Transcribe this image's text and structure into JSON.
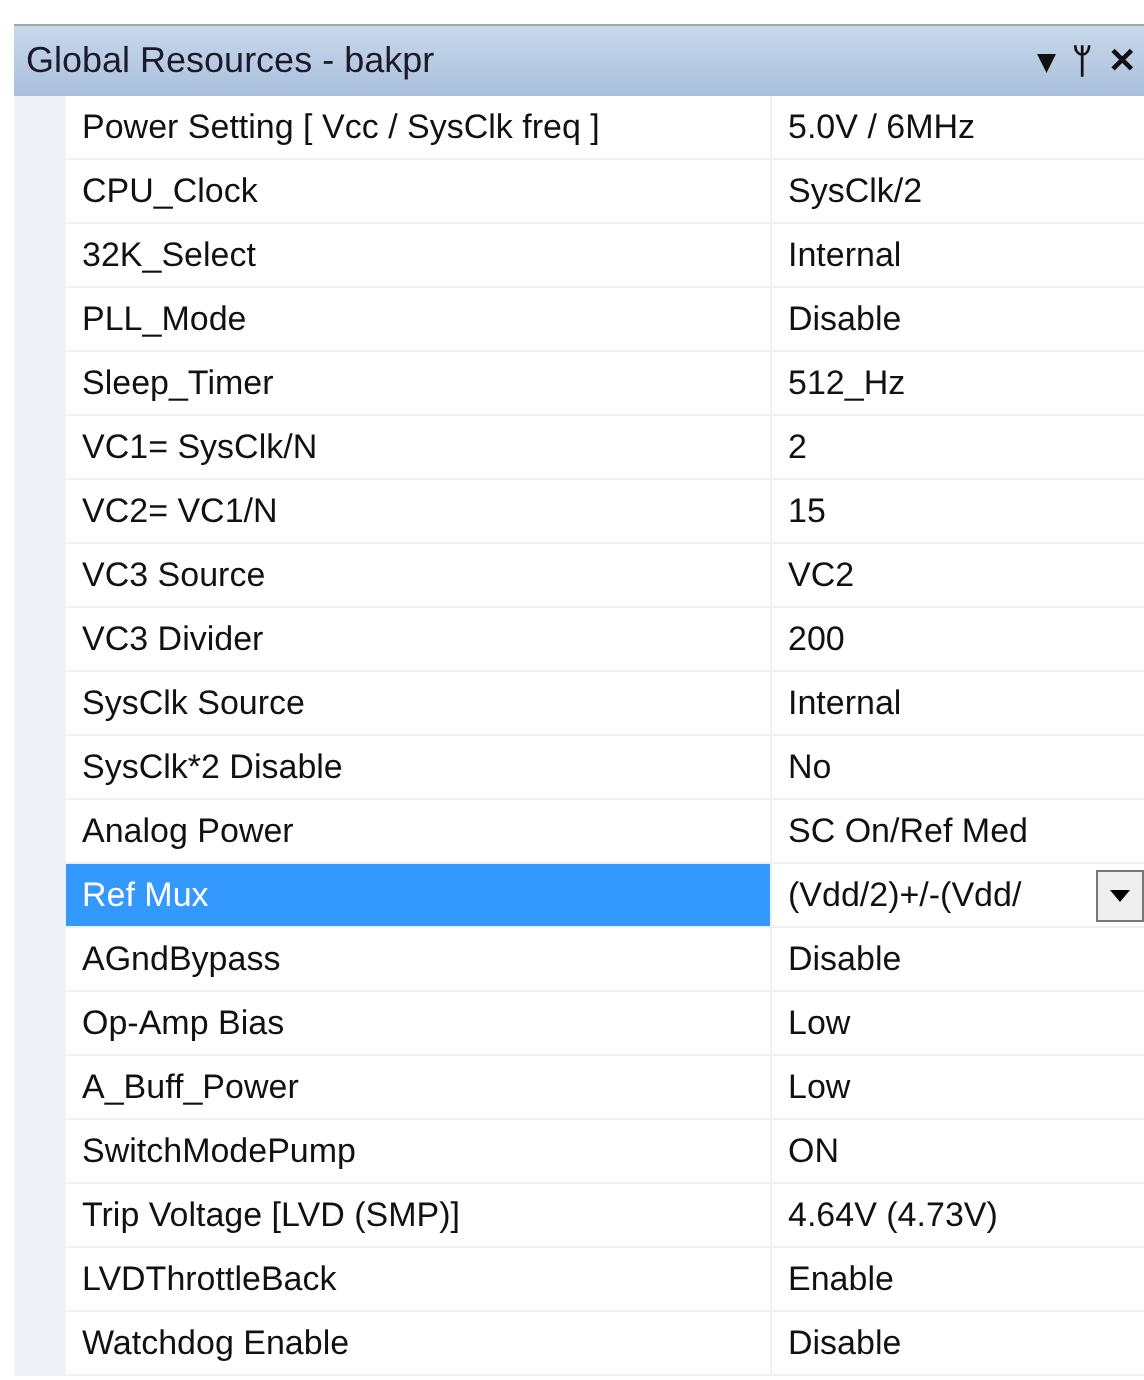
{
  "window": {
    "title": "Global Resources - bakpr",
    "buttons": [
      "▾",
      "ᛘ",
      "✕"
    ]
  },
  "properties": [
    {
      "name": "Power Setting [ Vcc / SysClk freq ]",
      "value": "5.0V / 6MHz",
      "selected": false
    },
    {
      "name": "CPU_Clock",
      "value": "SysClk/2",
      "selected": false
    },
    {
      "name": "32K_Select",
      "value": "Internal",
      "selected": false
    },
    {
      "name": "PLL_Mode",
      "value": "Disable",
      "selected": false
    },
    {
      "name": "Sleep_Timer",
      "value": "512_Hz",
      "selected": false
    },
    {
      "name": "VC1= SysClk/N",
      "value": "2",
      "selected": false
    },
    {
      "name": "VC2= VC1/N",
      "value": "15",
      "selected": false
    },
    {
      "name": "VC3 Source",
      "value": "VC2",
      "selected": false
    },
    {
      "name": "VC3 Divider",
      "value": "200",
      "selected": false
    },
    {
      "name": "SysClk Source",
      "value": "Internal",
      "selected": false
    },
    {
      "name": "SysClk*2 Disable",
      "value": "No",
      "selected": false
    },
    {
      "name": "Analog Power",
      "value": "SC On/Ref Med",
      "selected": false
    },
    {
      "name": "Ref Mux",
      "value": "(Vdd/2)+/-(Vdd/",
      "selected": true
    },
    {
      "name": "AGndBypass",
      "value": "Disable",
      "selected": false
    },
    {
      "name": "Op-Amp Bias",
      "value": "Low",
      "selected": false
    },
    {
      "name": "A_Buff_Power",
      "value": "Low",
      "selected": false
    },
    {
      "name": "SwitchModePump",
      "value": "ON",
      "selected": false
    },
    {
      "name": "Trip Voltage [LVD (SMP)]",
      "value": "4.64V (4.73V)",
      "selected": false
    },
    {
      "name": "LVDThrottleBack",
      "value": "Enable",
      "selected": false
    },
    {
      "name": "Watchdog Enable",
      "value": "Disable",
      "selected": false
    }
  ]
}
